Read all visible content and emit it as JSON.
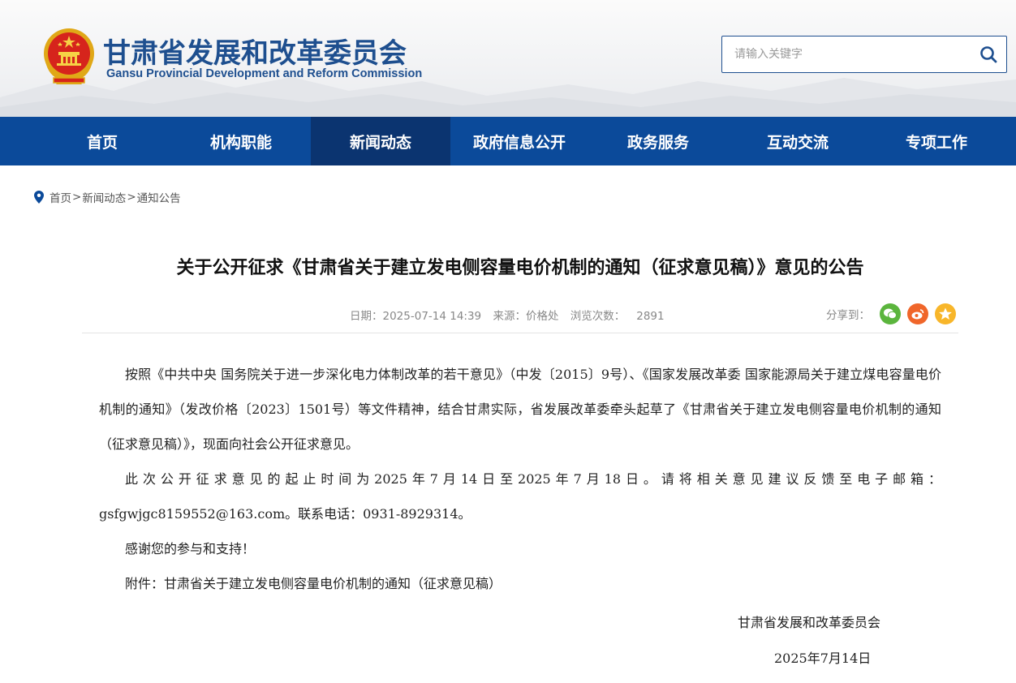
{
  "header": {
    "title": "甘肃省发展和改革委员会",
    "subtitle": "Gansu Provincial Development and Reform Commission",
    "search_placeholder": "请输入关键字"
  },
  "nav": {
    "items": [
      {
        "label": "首页"
      },
      {
        "label": "机构职能"
      },
      {
        "label": "新闻动态",
        "active": true
      },
      {
        "label": "政府信息公开"
      },
      {
        "label": "政务服务"
      },
      {
        "label": "互动交流"
      },
      {
        "label": "专项工作"
      }
    ]
  },
  "breadcrumb": {
    "items": [
      "首页",
      "新闻动态",
      "通知公告"
    ],
    "separator": ">"
  },
  "article": {
    "title": "关于公开征求《甘肃省关于建立发电侧容量电价机制的通知（征求意见稿）》意见的公告",
    "meta": {
      "date": "日期：2025-07-14 14:39",
      "source": "来源：价格处",
      "views_label": "浏览次数：",
      "views": "2891"
    },
    "share": {
      "label": "分享到：",
      "icons": [
        "wechat-icon",
        "weibo-icon",
        "qzone-icon"
      ]
    },
    "paragraphs": [
      "按照《中共中央 国务院关于进一步深化电力体制改革的若干意见》（中发〔2015〕9号）、《国家发展改革委 国家能源局关于建立煤电容量电价机制的通知》（发改价格〔2023〕1501号）等文件精神，结合甘肃实际，省发展改革委牵头起草了《甘肃省关于建立发电侧容量电价机制的通知（征求意见稿）》，现面向社会公开征求意见。",
      "此次公开征求意见的起止时间为2025年7月14日至2025年7月18日。请将相关意见建议反馈至电子邮箱：",
      "gsfgwjgc8159552@163.com。联系电话：0931-8929314。",
      "感谢您的参与和支持！",
      "附件：甘肃省关于建立发电侧容量电价机制的通知（征求意见稿）"
    ],
    "signature": "甘肃省发展和改革委员会",
    "signature_date": "2025年7月14日"
  },
  "colors": {
    "brand_blue": "#0b4a9a",
    "nav_active": "#0b3470",
    "title_blue": "#1e4f8f",
    "wechat": "#5bb53d",
    "weibo": "#f0662a",
    "qzone": "#f8b62a"
  }
}
